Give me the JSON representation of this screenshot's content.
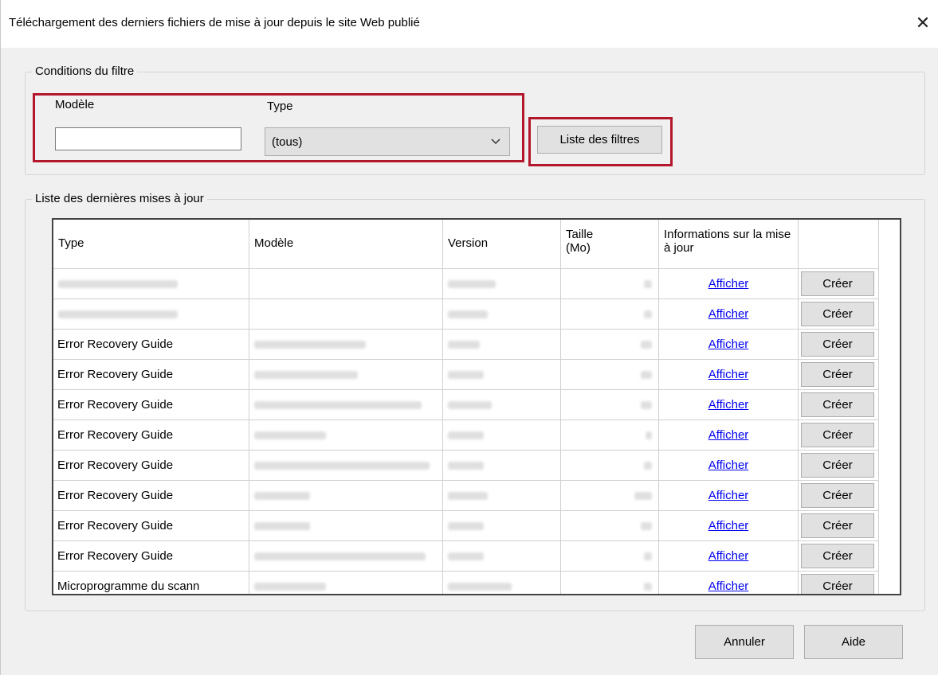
{
  "dialog": {
    "title": "Téléchargement des derniers fichiers de mise à jour depuis le site Web publié",
    "close_glyph": "✕"
  },
  "filter": {
    "group_label": "Conditions du filtre",
    "model_label": "Modèle",
    "model_value": "",
    "type_label": "Type",
    "type_value": "(tous)",
    "filter_list_button": "Liste des filtres"
  },
  "updates": {
    "group_label": "Liste des dernières mises à jour",
    "columns": [
      "Type",
      "Modèle",
      "Version",
      "Taille\n(Mo)",
      "Informations sur la mise à jour",
      ""
    ],
    "rows": [
      {
        "type": "",
        "link": "Afficher",
        "action": "Créer"
      },
      {
        "type": "",
        "link": "Afficher",
        "action": "Créer"
      },
      {
        "type": "Error Recovery Guide",
        "link": "Afficher",
        "action": "Créer"
      },
      {
        "type": "Error Recovery Guide",
        "link": "Afficher",
        "action": "Créer"
      },
      {
        "type": "Error Recovery Guide",
        "link": "Afficher",
        "action": "Créer"
      },
      {
        "type": "Error Recovery Guide",
        "link": "Afficher",
        "action": "Créer"
      },
      {
        "type": "Error Recovery Guide",
        "link": "Afficher",
        "action": "Créer"
      },
      {
        "type": "Error Recovery Guide",
        "link": "Afficher",
        "action": "Créer"
      },
      {
        "type": "Error Recovery Guide",
        "link": "Afficher",
        "action": "Créer"
      },
      {
        "type": "Error Recovery Guide",
        "link": "Afficher",
        "action": "Créer"
      },
      {
        "type": "Microprogramme du scann",
        "link": "Afficher",
        "action": "Créer"
      }
    ]
  },
  "footer": {
    "cancel_button": "Annuler",
    "help_button": "Aide"
  },
  "colors": {
    "highlight": "#b3172b",
    "link": "#0000ee"
  }
}
